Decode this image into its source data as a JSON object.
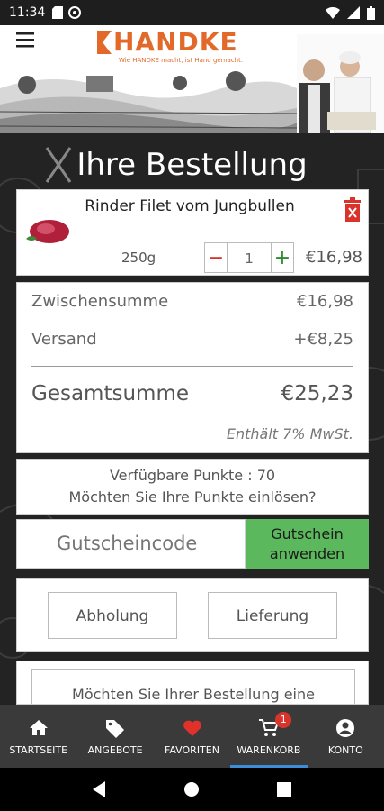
{
  "status_bar": {
    "time": "11:34"
  },
  "header": {
    "brand": "HANDKE",
    "slogan": "Wie HANDKE macht, ist Hand gemacht."
  },
  "page": {
    "title": "Ihre Bestellung"
  },
  "cart_item": {
    "name": "Rinder Filet vom Jungbullen",
    "weight": "250g",
    "quantity": "1",
    "minus_label": "−",
    "plus_label": "+",
    "price": "€16,98"
  },
  "summary": {
    "subtotal_label": "Zwischensumme",
    "subtotal_value": "€16,98",
    "shipping_label": "Versand",
    "shipping_value": "+€8,25",
    "total_label": "Gesamtsumme",
    "total_value": "€25,23",
    "vat_note": "Enthält 7% MwSt."
  },
  "points": {
    "available": "Verfügbare Punkte : 70",
    "question": "Möchten Sie Ihre Punkte einlösen?"
  },
  "voucher": {
    "placeholder": "Gutscheincode",
    "button_line1": "Gutschein",
    "button_line2": "anwenden",
    "button_color": "#5cb85c"
  },
  "delivery": {
    "pickup": "Abholung",
    "delivery": "Lieferung"
  },
  "note": {
    "text": "Möchten Sie Ihrer Bestellung eine"
  },
  "bottom_nav": {
    "items": [
      {
        "label": "STARTSEITE",
        "icon": "home-icon"
      },
      {
        "label": "ANGEBOTE",
        "icon": "tag-icon"
      },
      {
        "label": "FAVORITEN",
        "icon": "heart-icon"
      },
      {
        "label": "WARENKORB",
        "icon": "cart-icon",
        "badge": "1",
        "active": true
      },
      {
        "label": "KONTO",
        "icon": "account-icon"
      }
    ]
  },
  "colors": {
    "brand_orange": "#e2692a",
    "delete_red": "#d9342b",
    "plus_green": "#2e8b2e",
    "active_blue": "#3b8fd9"
  }
}
